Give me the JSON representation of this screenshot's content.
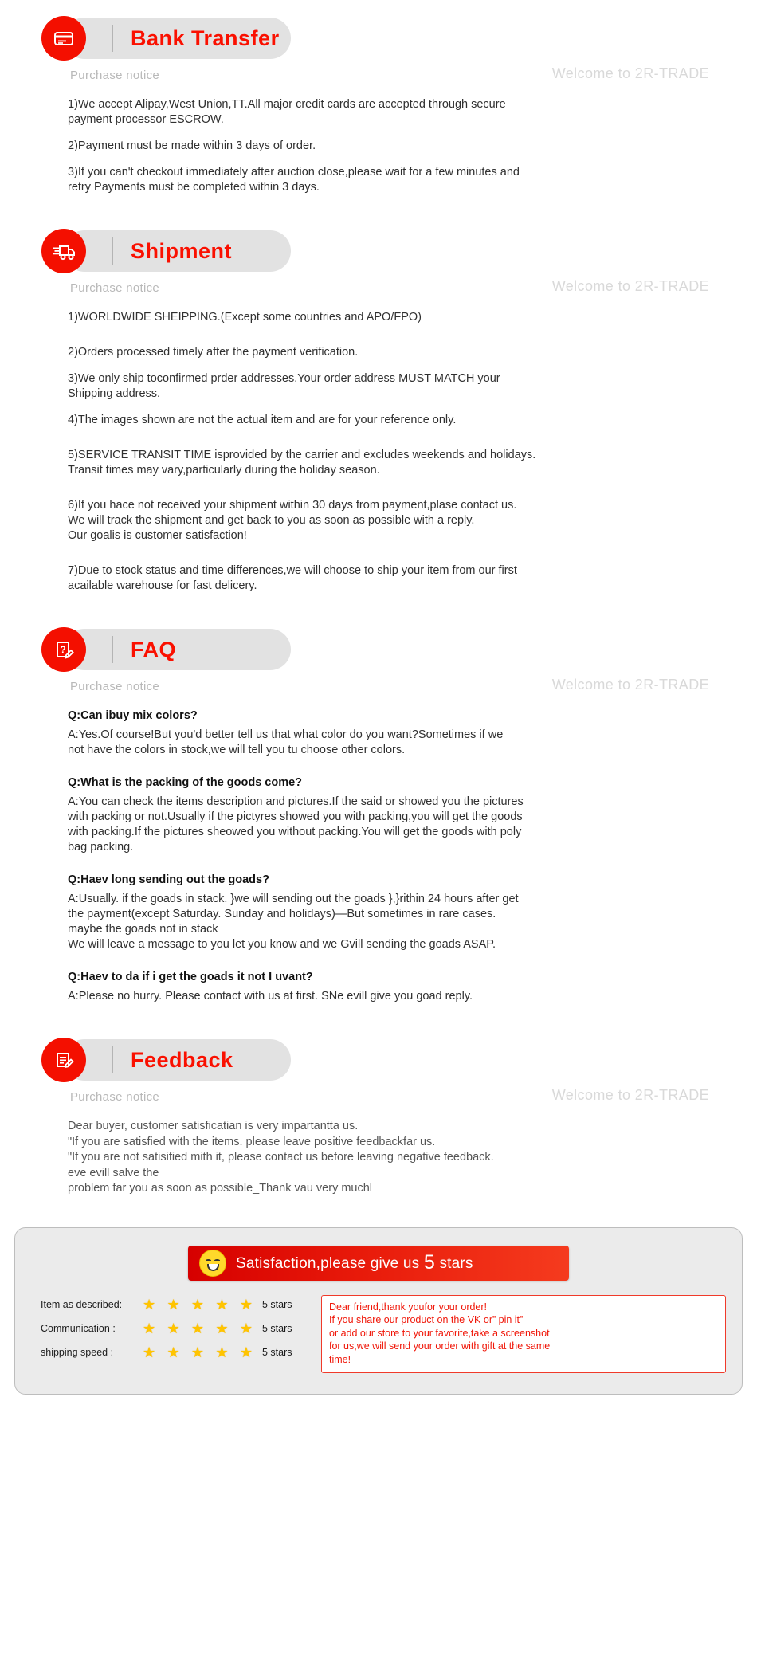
{
  "common": {
    "purchase_notice": "Purchase notice",
    "welcome": "Welcome to 2R-TRADE"
  },
  "sections": {
    "bank": {
      "title": "Bank Transfer",
      "icon": "credit-card-icon",
      "paragraphs": [
        "1)We accept Alipay,West Union,TT.All major credit cards are accepted through secure\npayment processor ESCROW.",
        "2)Payment must be made within 3 days of order.",
        "3)If you can't checkout immediately after auction close,please wait for a few minutes and\nretry Payments must be completed within 3 days."
      ]
    },
    "shipment": {
      "title": "Shipment",
      "icon": "delivery-truck-icon",
      "paragraphs": [
        "1)WORLDWIDE SHEIPPING.(Except some countries and APO/FPO)",
        "2)Orders processed timely after the payment verification.",
        "3)We only ship toconfirmed prder addresses.Your order address MUST MATCH your\nShipping address.",
        "4)The images shown are not the actual item and are for your reference only.",
        "5)SERVICE TRANSIT TIME isprovided by the carrier and excludes weekends and holidays.\nTransit times may vary,particularly during the holiday season.",
        "6)If you hace not received your shipment within 30 days from payment,plase contact us.\nWe will track the shipment and get back to you as soon as possible with a reply.\nOur goalis is customer satisfaction!",
        "7)Due to stock status and time differences,we will choose to ship your item from our first\nacailable warehouse for fast delicery."
      ]
    },
    "faq": {
      "title": "FAQ",
      "icon": "question-document-icon",
      "items": [
        {
          "q": "Q:Can ibuy mix colors?",
          "a": "A:Yes.Of course!But you'd better tell us that what color do you want?Sometimes if we\nnot have the colors in stock,we will tell you tu choose other colors."
        },
        {
          "q": "Q:What is the packing of the goods come?",
          "a": "A:You can check the items description and pictures.If the said or showed you the pictures\nwith packing or not.Usually if the pictyres showed you with packing,you will get the goods\nwith packing.If the pictures sheowed you without packing.You will get the goods with poly\nbag packing."
        },
        {
          "q": "Q:Haev long sending out the goads?",
          "a": "A:Usually. if the goads in stack. }we will sending out the goads },}rithin 24 hours after get\nthe payment(except Saturday. Sunday and holidays)—But sometimes in rare cases.\nmaybe the goads not in stack\nWe will leave a message to you let you know and we Gvill sending the goads ASAP."
        },
        {
          "q": "Q:Haev to da if i get the goads it not I uvant?",
          "a": "A:Please no hurry. Please contact with us at first. SNe evill give you goad reply."
        }
      ]
    },
    "feedback": {
      "title": "Feedback",
      "icon": "edit-document-icon",
      "text": "Dear buyer, customer satisficatian is very impartantta us.\n\"If you are satisfied with the items. please leave positive feedbackfar us.\n\"If you are not satisified mith it, please contact us before leaving negative feedback.\neve evill salve the\nproblem far you as soon as possible_Thank vau very muchl"
    }
  },
  "rating": {
    "banner_prefix": "Satisfaction,please give us ",
    "banner_number": "5",
    "banner_suffix": " stars",
    "smiley_icon": "smiley-face-icon",
    "rows": [
      {
        "label": "Item as described:",
        "stars": 5,
        "value": "5 stars"
      },
      {
        "label": "Communication  :",
        "stars": 5,
        "value": "5 stars"
      },
      {
        "label": "shipping speed  :",
        "stars": 5,
        "value": "5 stars"
      }
    ],
    "star_glyph": "★",
    "promo_text": "Dear friend,thank youfor your order!\nIf you share our product on the VK or” pin it”\nor add our store to your favorite,take a screenshot\nfor us,we will send your order with gift at the same\ntime!"
  },
  "colors": {
    "accent_red": "#fa1000",
    "pill_gray": "#e2e2e2",
    "star_gold": "#ffc400"
  }
}
